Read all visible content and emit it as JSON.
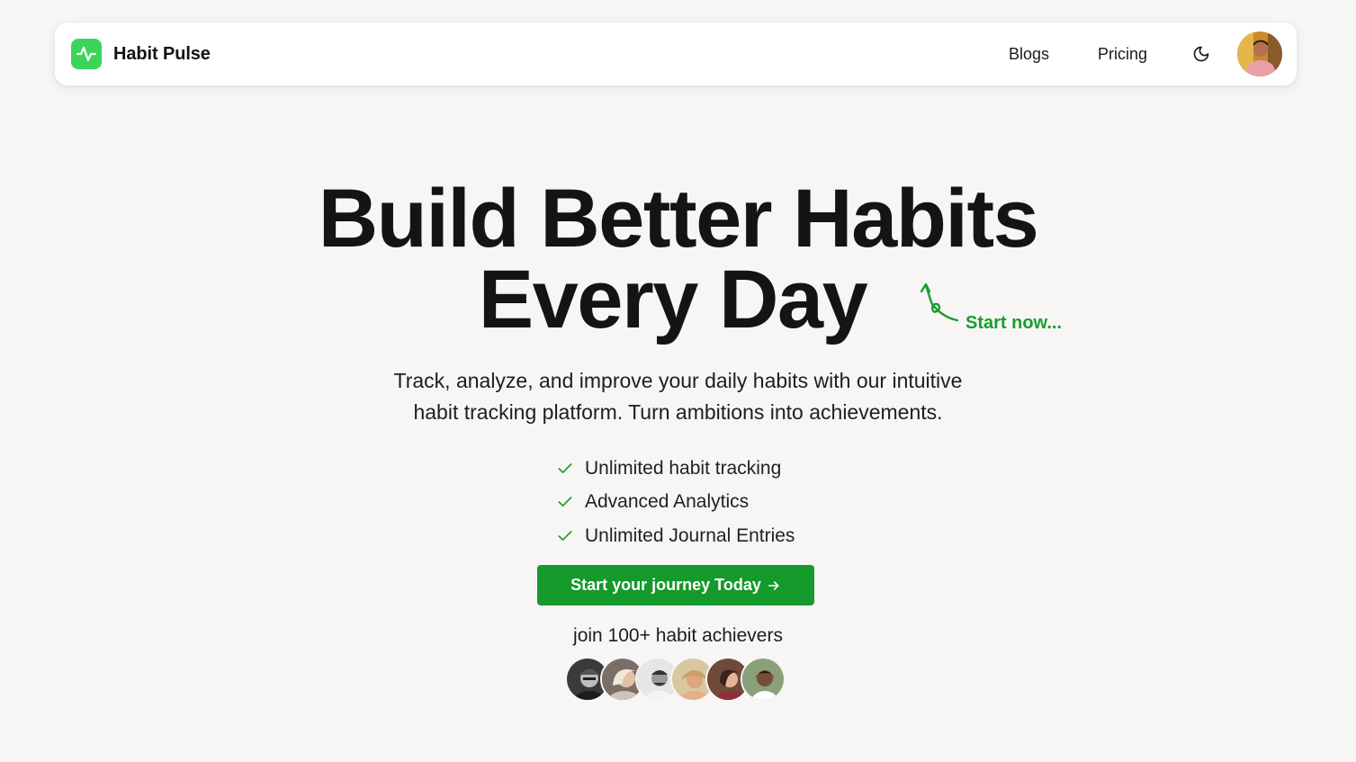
{
  "nav": {
    "brand": "Habit Pulse",
    "links": [
      "Blogs",
      "Pricing"
    ],
    "theme_toggle_icon": "moon-icon",
    "logo_color": "#3bd45a"
  },
  "hero": {
    "title_line_1": "Build Better Habits",
    "title_line_2": "Every Day",
    "annotation": "Start now...",
    "subtitle_line_1": "Track, analyze, and improve your daily habits with our intuitive",
    "subtitle_line_2": "habit tracking platform. Turn ambitions into achievements.",
    "features": [
      "Unlimited habit tracking",
      "Advanced Analytics",
      "Unlimited Journal Entries"
    ],
    "cta_label": "Start your journey Today",
    "join_text": "join 100+ habit achievers",
    "accent_color": "#149a2b"
  }
}
